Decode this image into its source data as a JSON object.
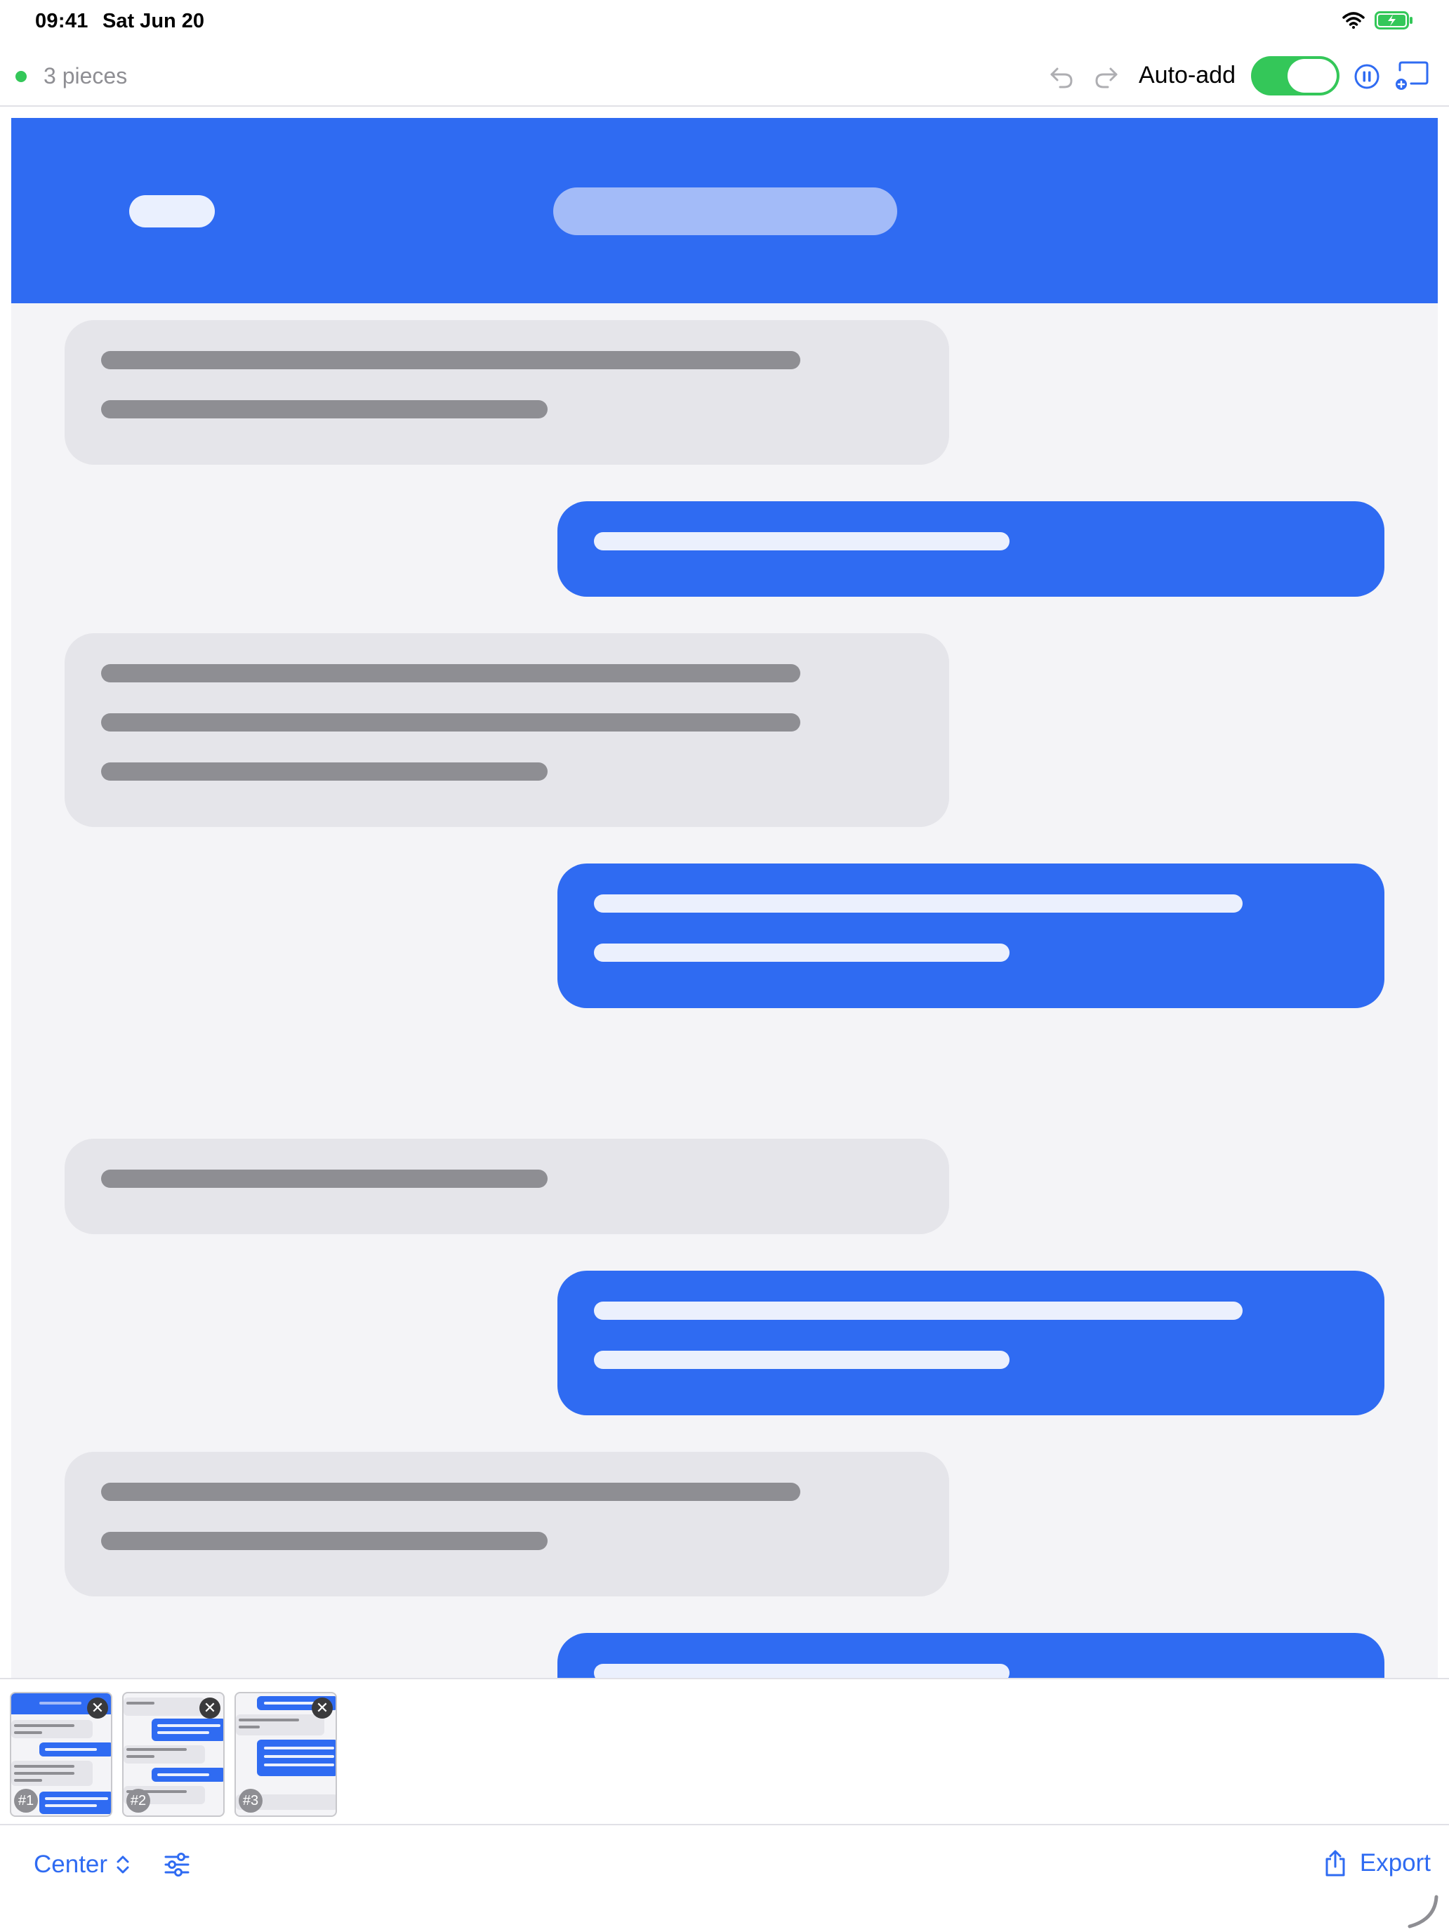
{
  "status_bar": {
    "time": "09:41",
    "date": "Sat Jun 20",
    "battery_color": "#34c759"
  },
  "toolbar": {
    "pieces_label": "3 pieces",
    "status_dot_color": "#34c759",
    "auto_add_label": "Auto-add",
    "auto_add_on": true,
    "accent": "#2f6bf2"
  },
  "thumbnails": [
    {
      "number": "#1",
      "close_icon": "close-icon"
    },
    {
      "number": "#2",
      "close_icon": "close-icon"
    },
    {
      "number": "#3",
      "close_icon": "close-icon"
    }
  ],
  "bottom_bar": {
    "alignment_label": "Center",
    "export_label": "Export"
  },
  "icons": [
    "wifi-icon",
    "battery-icon",
    "undo-icon",
    "redo-icon",
    "pause-icon",
    "cast-icon",
    "chevron-up-down-icon",
    "sliders-icon",
    "share-icon"
  ]
}
